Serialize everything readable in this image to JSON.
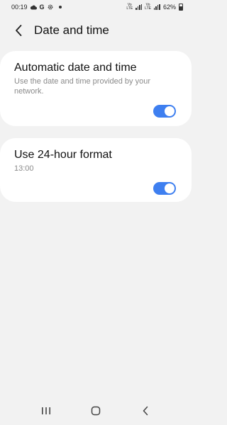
{
  "status_bar": {
    "time": "00:19",
    "battery_text": "62%",
    "battery_level": 0.62,
    "icons": [
      "cloud-icon",
      "google-icon",
      "settings-gear-icon",
      "dot-icon",
      "volte-icon",
      "wifi-calling-icon",
      "signal-icon",
      "battery-icon"
    ]
  },
  "header": {
    "title": "Date and time",
    "back_icon": "chevron-left-icon"
  },
  "settings": {
    "automatic": {
      "title": "Automatic date and time",
      "subtitle": "Use the date and time provided by your network.",
      "enabled": true
    },
    "format24": {
      "title": "Use 24-hour format",
      "subtitle": "13:00",
      "enabled": true
    }
  },
  "nav_bar": {
    "recents_icon": "recents-icon",
    "home_icon": "home-icon",
    "back_icon": "back-arrow-icon"
  },
  "colors": {
    "accent": "#3e7ff0",
    "background": "#f2f2f2",
    "card": "#ffffff",
    "secondary_text": "#8a8a8a"
  }
}
